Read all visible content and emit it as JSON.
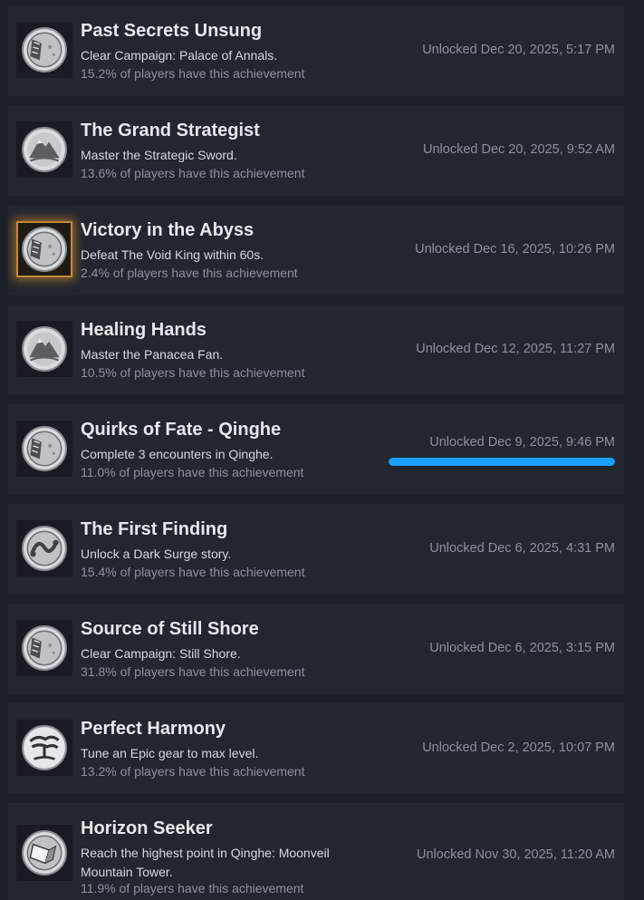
{
  "accent": "#1a9fff",
  "rare_glow": "#e69628",
  "achievements": [
    {
      "title": "Past Secrets Unsung",
      "description": "Clear Campaign: Palace of Annals.",
      "percent": "15.2% of players have this achievement",
      "unlocked": "Unlocked Dec 20, 2025, 5:17 PM",
      "icon": "moon-book-icon"
    },
    {
      "title": "The Grand Strategist",
      "description": "Master the Strategic Sword.",
      "percent": "13.6% of players have this achievement",
      "unlocked": "Unlocked Dec 20, 2025, 9:52 AM",
      "icon": "mountain-icon"
    },
    {
      "title": "Victory in the Abyss",
      "description": "Defeat The Void King within 60s.",
      "percent": "2.4% of players have this achievement",
      "unlocked": "Unlocked Dec 16, 2025, 10:26 PM",
      "icon": "moon-book-icon",
      "rare": true
    },
    {
      "title": "Healing Hands",
      "description": "Master the Panacea Fan.",
      "percent": "10.5% of players have this achievement",
      "unlocked": "Unlocked Dec 12, 2025, 11:27 PM",
      "icon": "mountain-icon"
    },
    {
      "title": "Quirks of Fate - Qinghe",
      "description": "Complete 3 encounters in Qinghe.",
      "percent": "11.0% of players have this achievement",
      "unlocked": "Unlocked Dec 9, 2025, 9:46 PM",
      "icon": "moon-book-icon",
      "progress": 1.0
    },
    {
      "title": "The First Finding",
      "description": "Unlock a Dark Surge story.",
      "percent": "15.4% of players have this achievement",
      "unlocked": "Unlocked Dec 6, 2025, 4:31 PM",
      "icon": "swirl-icon"
    },
    {
      "title": "Source of Still Shore",
      "description": "Clear Campaign: Still Shore.",
      "percent": "31.8% of players have this achievement",
      "unlocked": "Unlocked Dec 6, 2025, 3:15 PM",
      "icon": "moon-book-icon"
    },
    {
      "title": "Perfect Harmony",
      "description": "Tune an Epic gear to max level.",
      "percent": "13.2% of players have this achievement",
      "unlocked": "Unlocked Dec 2, 2025, 10:07 PM",
      "icon": "tree-icon"
    },
    {
      "title": "Horizon Seeker",
      "description": "Reach the highest point in Qinghe: Moonveil Mountain Tower.",
      "percent": "11.9% of players have this achievement",
      "unlocked": "Unlocked Nov 30, 2025, 11:20 AM",
      "icon": "scroll-icon"
    }
  ]
}
